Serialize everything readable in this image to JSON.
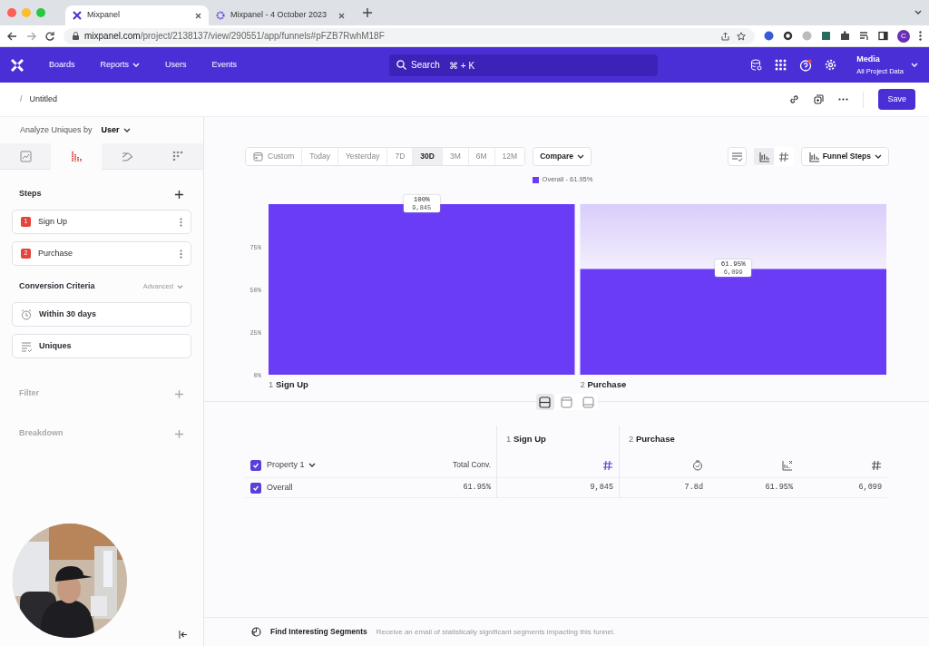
{
  "browser": {
    "tabs": [
      {
        "title": "Mixpanel",
        "selected": true
      },
      {
        "title": "Mixpanel - 4 October 2023",
        "selected": false
      }
    ],
    "url_host": "mixpanel.com",
    "url_path": "/project/2138137/view/290551/app/funnels#pFZB7RwhM18F",
    "avatar_letter": "C"
  },
  "nav": {
    "items": [
      {
        "label": "Boards",
        "dropdown": false
      },
      {
        "label": "Reports",
        "dropdown": true
      },
      {
        "label": "Users",
        "dropdown": false
      },
      {
        "label": "Events",
        "dropdown": false
      }
    ],
    "search": {
      "placeholder": "Search",
      "shortcut": "⌘ + K"
    },
    "project": {
      "name": "Media",
      "subtitle": "All Project Data"
    }
  },
  "subheader": {
    "separator": "/",
    "title": "Untitled",
    "save": "Save"
  },
  "sidebar": {
    "analyze_label": "Analyze Uniques by",
    "analyze_value": "User",
    "report_tabs": [
      {
        "kind": "insights",
        "selected": false
      },
      {
        "kind": "funnels",
        "selected": true
      },
      {
        "kind": "flows",
        "selected": false
      },
      {
        "kind": "retention",
        "selected": false
      }
    ],
    "steps_title": "Steps",
    "steps": [
      {
        "number": "1",
        "label": "Sign Up"
      },
      {
        "number": "2",
        "label": "Purchase"
      }
    ],
    "criteria_title": "Conversion Criteria",
    "criteria_mode": "Advanced",
    "criteria": [
      {
        "kind": "window",
        "label": "Within 30 days"
      },
      {
        "kind": "counting",
        "label": "Uniques"
      }
    ],
    "sections": [
      {
        "label": "Filter"
      },
      {
        "label": "Breakdown"
      }
    ]
  },
  "toolbar": {
    "ranges": [
      {
        "label": "Custom",
        "kind": "calendar",
        "selected": false
      },
      {
        "label": "Today",
        "kind": "text",
        "selected": false
      },
      {
        "label": "Yesterday",
        "kind": "text",
        "selected": false
      },
      {
        "label": "7D",
        "kind": "text",
        "selected": false
      },
      {
        "label": "30D",
        "kind": "text",
        "selected": true
      },
      {
        "label": "3M",
        "kind": "text",
        "selected": false
      },
      {
        "label": "6M",
        "kind": "text",
        "selected": false
      },
      {
        "label": "12M",
        "kind": "text",
        "selected": false
      }
    ],
    "compare": "Compare",
    "display_toggles": [
      {
        "kind": "bars",
        "selected": true
      },
      {
        "kind": "hash",
        "selected": false
      }
    ],
    "view": "Funnel Steps"
  },
  "chart": {
    "chart_data": {
      "type": "bar",
      "categories": [
        "1 **Sign Up**",
        "2 **Purchase**"
      ],
      "series": [
        {
          "name": "Overall - 61.95%",
          "color": "#6a3cf5",
          "values": [
            100,
            62
          ]
        }
      ],
      "ylim": [
        0,
        100
      ],
      "yticks": [
        {
          "value": 0,
          "label": "0%"
        },
        {
          "value": 25,
          "label": "25%"
        },
        {
          "value": 50,
          "label": "50%"
        },
        {
          "value": 75,
          "label": "75%"
        }
      ],
      "value_labels": [
        "100%",
        "61.95%"
      ],
      "annotations": [
        "9,845",
        "6,099"
      ]
    }
  },
  "layout_toggles": [
    {
      "kind": "split",
      "selected": true
    },
    {
      "kind": "top",
      "selected": false
    },
    {
      "kind": "bottom",
      "selected": false
    }
  ],
  "table": {
    "header_checked": true,
    "property": "Property 1",
    "total": "Total Conv.",
    "groups": [
      {
        "title": "1 **Sign Up**",
        "columns": [
          {
            "kind": "hash"
          }
        ]
      },
      {
        "title": "2 **Purchase**",
        "columns": [
          {
            "kind": "time"
          },
          {
            "kind": "conversion"
          },
          {
            "kind": "hash"
          }
        ]
      }
    ],
    "rows": [
      {
        "checked": true,
        "label": "Overall",
        "cells": [
          "61.95%",
          "9,845",
          "7.8d",
          "61.95%",
          "6,099"
        ]
      }
    ]
  },
  "footer": {
    "title": "Find Interesting Segments",
    "text": "Receive an email of statistically significant segments impacting this funnel."
  }
}
